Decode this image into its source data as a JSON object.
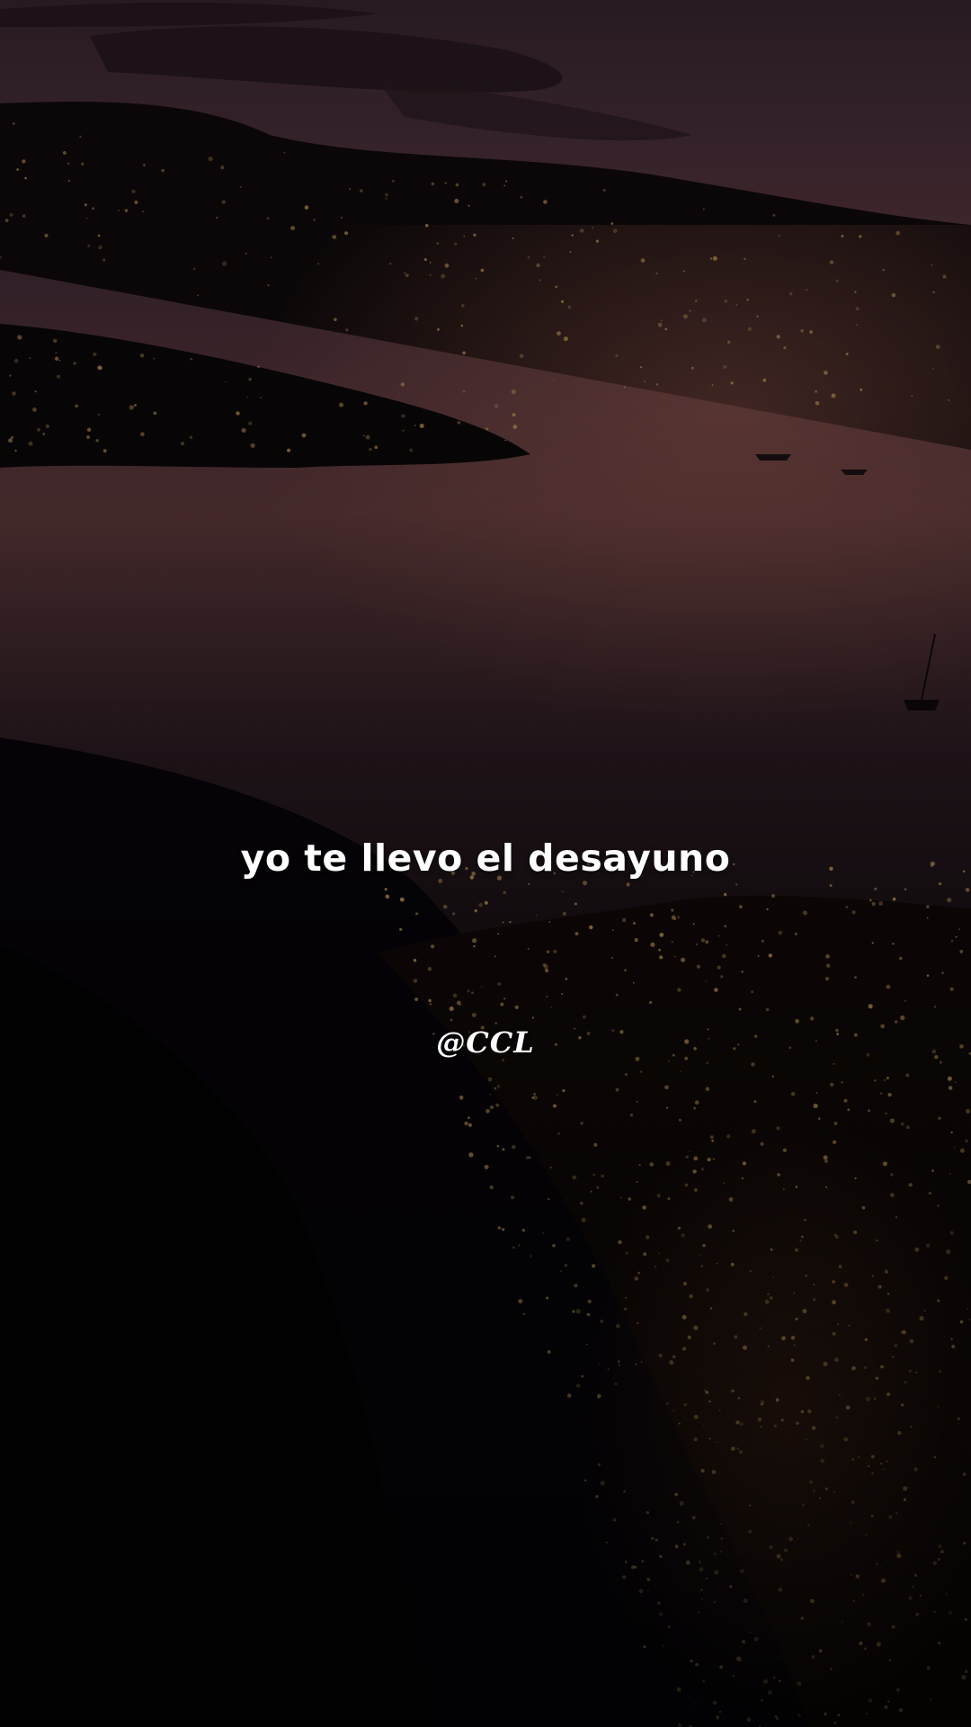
{
  "video": {
    "subtitle": "yo te llevo el desayuno",
    "watermark": "@CCL"
  },
  "background": {
    "scene": "aerial night view of a coastal city and bay with hills at dusk",
    "colors": {
      "sky": "#3a2630",
      "dusk_glow": "#7a4a44",
      "water": "#2a1c24",
      "land": "#0c0709",
      "city_lights": "#f2c070"
    }
  }
}
